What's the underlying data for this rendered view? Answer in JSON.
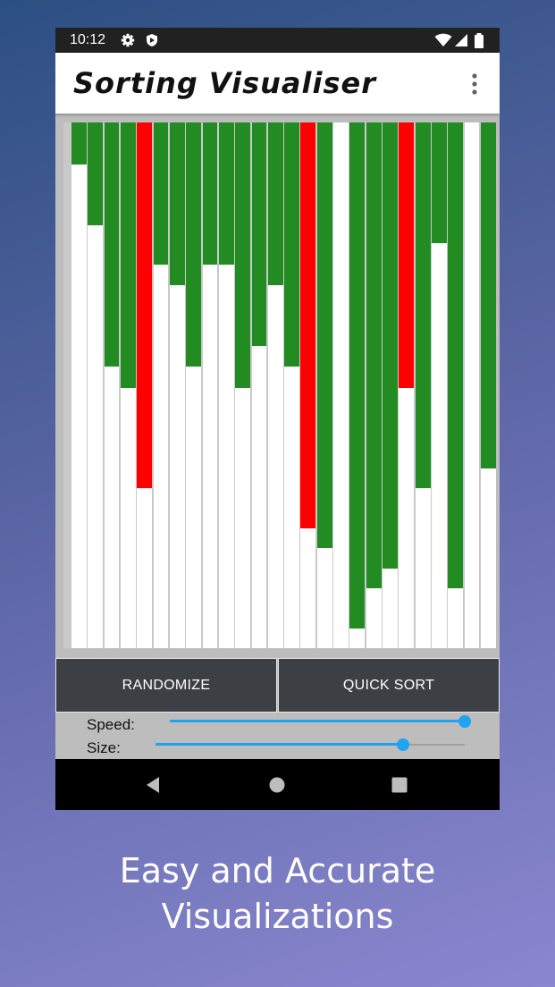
{
  "status_bar": {
    "time": "10:12",
    "left_icons": [
      "settings-icon",
      "shield-icon"
    ],
    "right_icons": [
      "wifi-icon",
      "signal-icon",
      "battery-icon"
    ]
  },
  "app_bar": {
    "title": "Sorting Visualiser",
    "menu_icon": "more-vert-icon"
  },
  "visualizer": {
    "colors": {
      "unsorted": "#228b22",
      "active": "#ff0000",
      "background": "#ffffff",
      "frame": "#c9c9c9"
    },
    "bar_fractions": [
      0.92,
      0.805,
      0.535,
      0.495,
      0.305,
      0.73,
      0.69,
      0.535,
      0.73,
      0.73,
      0.495,
      0.575,
      0.69,
      0.535,
      0.228,
      0.19,
      1.0,
      0.038,
      0.114,
      0.152,
      0.495,
      0.305,
      0.77,
      0.114,
      1.0,
      0.342
    ],
    "bar_states": [
      "sorted",
      "sorted",
      "sorted",
      "sorted",
      "active",
      "sorted",
      "sorted",
      "sorted",
      "sorted",
      "sorted",
      "sorted",
      "sorted",
      "sorted",
      "sorted",
      "active",
      "sorted",
      "sorted",
      "sorted",
      "sorted",
      "sorted",
      "active",
      "sorted",
      "sorted",
      "sorted",
      "sorted",
      "sorted"
    ]
  },
  "buttons": {
    "randomize": "RANDOMIZE",
    "quick_sort": "QUICK SORT"
  },
  "controls": {
    "speed": {
      "label": "Speed:",
      "value": 1.0
    },
    "size": {
      "label": "Size:",
      "value": 0.8
    }
  },
  "nav_bar": {
    "icons": [
      "back-icon",
      "home-icon",
      "recents-icon"
    ]
  },
  "caption": {
    "line1": "Easy and Accurate",
    "line2": "Visualizations"
  }
}
